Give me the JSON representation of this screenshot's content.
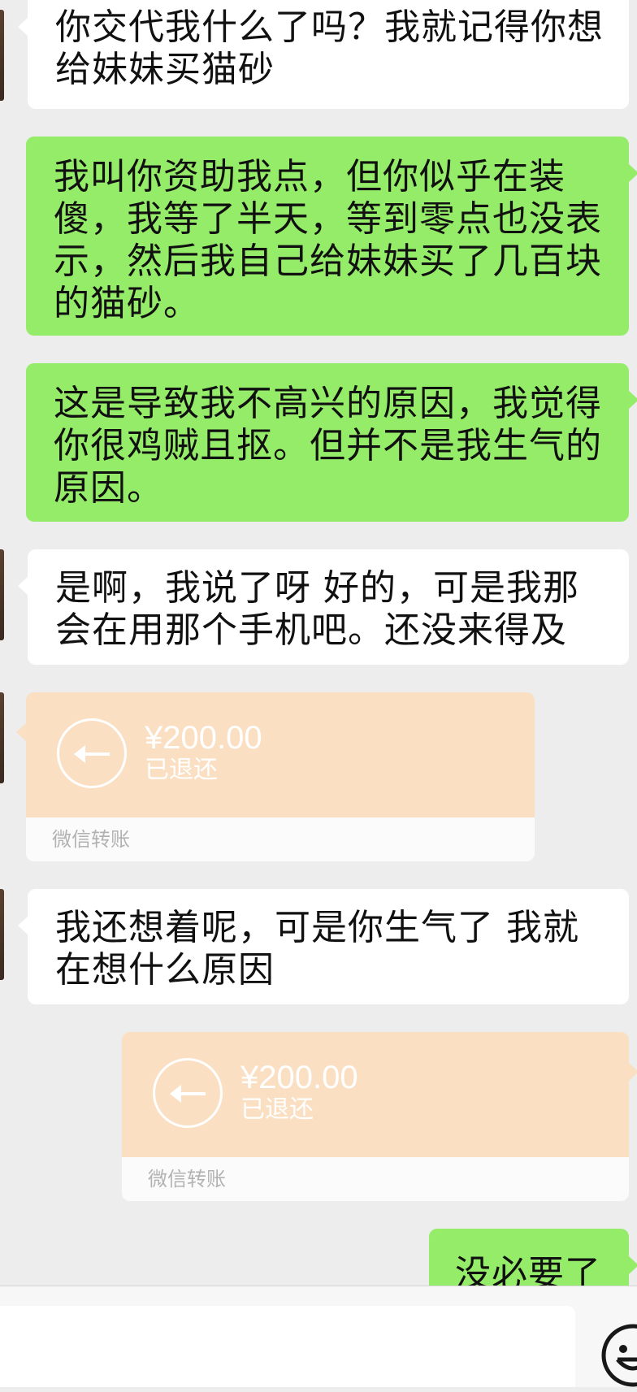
{
  "messages": [
    {
      "side": "in",
      "text_lines": [
        "你交代我什么了吗？我就记得你想",
        "给妹妹买猫砂"
      ]
    },
    {
      "side": "out",
      "text_lines": [
        "我叫你资助我点，但你似乎在装",
        "傻，我等了半天，等到零点也没表",
        "示，然后我自己给妹妹买了几百块",
        "的猫砂。"
      ]
    },
    {
      "side": "out",
      "text_lines": [
        "这是导致我不高兴的原因，我觉得",
        "你很鸡贼且抠。但并不是我生气的",
        "原因。"
      ]
    },
    {
      "side": "in",
      "text_lines": [
        "是啊，我说了呀 好的，可是我那",
        "会在用那个手机吧。还没来得及"
      ]
    },
    {
      "side": "in",
      "type": "transfer",
      "amount": "¥200.00",
      "status": "已退还",
      "label": "微信转账"
    },
    {
      "side": "in",
      "text_lines": [
        "我还想着呢，可是你生气了 我就",
        "在想什么原因"
      ]
    },
    {
      "side": "out",
      "type": "transfer",
      "amount": "¥200.00",
      "status": "已退还",
      "label": "微信转账"
    },
    {
      "side": "out",
      "text_lines": [
        "没必要了"
      ]
    }
  ],
  "input_bar": {
    "placeholder": "",
    "emoji_icon": "smiley-icon"
  },
  "colors": {
    "background": "#ededed",
    "outgoing": "#95ec69",
    "incoming": "#ffffff",
    "transfer": "#fbdfc2"
  }
}
